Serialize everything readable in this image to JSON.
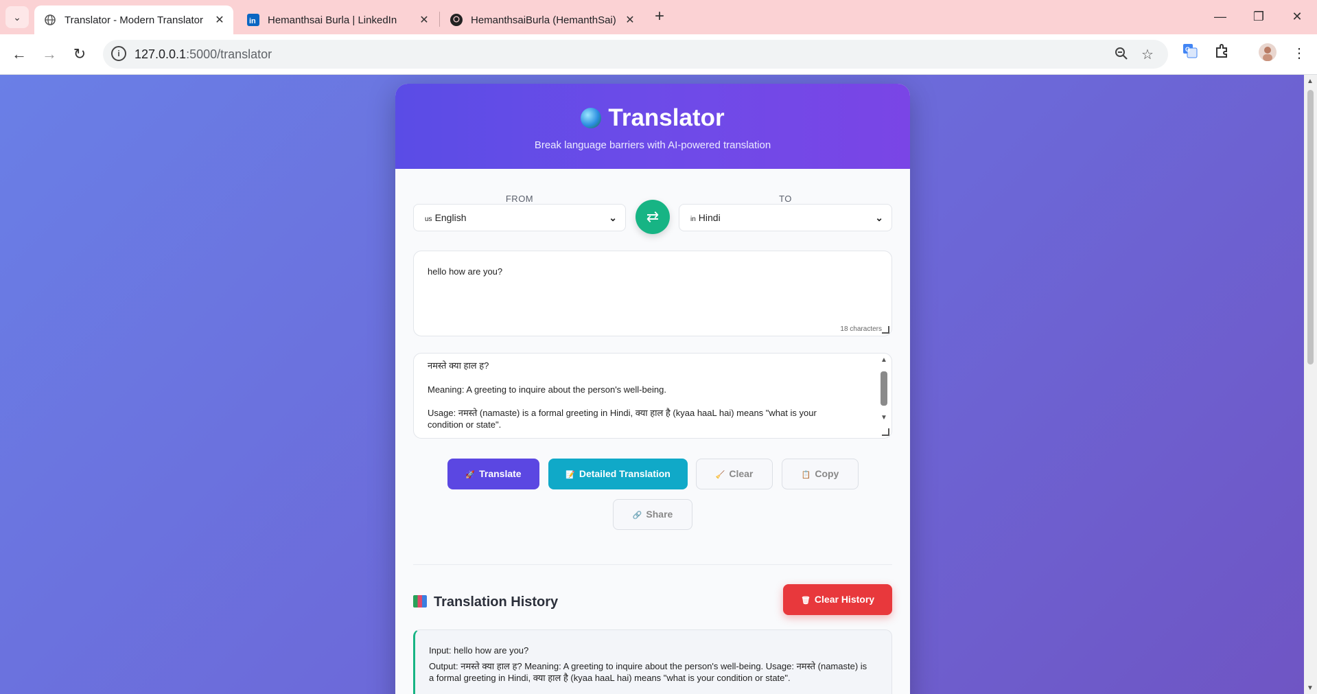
{
  "browser": {
    "tabs": [
      {
        "title": "Translator - Modern Translator",
        "icon": "globe-icon",
        "active": true
      },
      {
        "title": "Hemanthsai Burla | LinkedIn",
        "icon": "linkedin-icon",
        "active": false
      },
      {
        "title": "HemanthsaiBurla (HemanthSai)",
        "icon": "github-icon",
        "active": false
      }
    ],
    "url_host": "127.0.0.1",
    "url_path": ":5000/translator",
    "accent": "#fbd2d4"
  },
  "app": {
    "title": "Translator",
    "subtitle": "Break language barriers with AI-powered translation",
    "from_label": "FROM",
    "to_label": "TO",
    "from_lang": {
      "flag": "us",
      "name": "English"
    },
    "to_lang": {
      "flag": "in",
      "name": "Hindi"
    },
    "input_text": "hello how are you?",
    "char_count": "18 characters",
    "output": {
      "line1": "नमस्ते क्या हाल ह?",
      "line2": "Meaning: A greeting to inquire about the person's well-being.",
      "line3": "Usage: नमस्ते (namaste) is a formal greeting in Hindi, क्या हाल है (kyaa haaL hai) means \"what is your condition or state\"."
    },
    "buttons": {
      "translate": "Translate",
      "detailed": "Detailed Translation",
      "clear": "Clear",
      "copy": "Copy",
      "share": "Share",
      "clear_history": "Clear History"
    },
    "history": {
      "title": "Translation History",
      "items": [
        {
          "input": "Input: hello how are you?",
          "output": "Output: नमस्ते क्या हाल ह?   Meaning: A greeting to inquire about the person's well-being. Usage: नमस्ते (namaste) is a formal greeting in Hindi, क्या हाल है (kyaa haaL hai) means \"what is your condition or state\"."
        }
      ]
    },
    "colors": {
      "primary": "#5b47e2",
      "teal": "#10a9c8",
      "swap": "#17b484",
      "danger": "#e8383c"
    }
  }
}
